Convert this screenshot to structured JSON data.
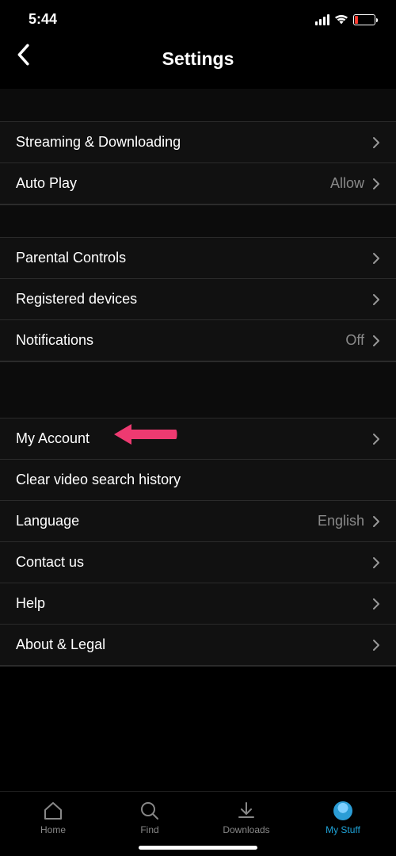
{
  "status": {
    "time": "5:44"
  },
  "header": {
    "title": "Settings"
  },
  "groups": [
    {
      "rows": [
        {
          "key": "streaming",
          "label": "Streaming & Downloading",
          "value": null,
          "chevron": true
        },
        {
          "key": "autoplay",
          "label": "Auto Play",
          "value": "Allow",
          "chevron": true
        }
      ]
    },
    {
      "rows": [
        {
          "key": "parental",
          "label": "Parental Controls",
          "value": null,
          "chevron": true
        },
        {
          "key": "devices",
          "label": "Registered devices",
          "value": null,
          "chevron": true
        },
        {
          "key": "notifications",
          "label": "Notifications",
          "value": "Off",
          "chevron": true
        }
      ]
    },
    {
      "rows": [
        {
          "key": "account",
          "label": "My Account",
          "value": null,
          "chevron": true
        },
        {
          "key": "clear",
          "label": "Clear video search history",
          "value": null,
          "chevron": false
        },
        {
          "key": "language",
          "label": "Language",
          "value": "English",
          "chevron": true
        },
        {
          "key": "contact",
          "label": "Contact us",
          "value": null,
          "chevron": true
        },
        {
          "key": "help",
          "label": "Help",
          "value": null,
          "chevron": true
        },
        {
          "key": "about",
          "label": "About & Legal",
          "value": null,
          "chevron": true
        }
      ]
    }
  ],
  "nav": {
    "items": [
      {
        "key": "home",
        "label": "Home",
        "active": false
      },
      {
        "key": "find",
        "label": "Find",
        "active": false
      },
      {
        "key": "downloads",
        "label": "Downloads",
        "active": false
      },
      {
        "key": "mystuff",
        "label": "My Stuff",
        "active": true
      }
    ]
  }
}
